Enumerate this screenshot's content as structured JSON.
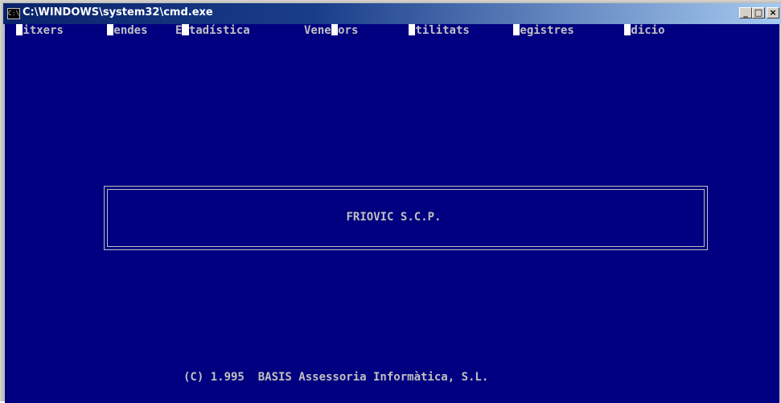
{
  "window": {
    "title": "C:\\WINDOWS\\system32\\cmd.exe",
    "icon_text": "C:\\",
    "controls": {
      "minimize": "_",
      "maximize": "□",
      "close": "×"
    }
  },
  "menu": {
    "items": [
      {
        "hotkey": "F",
        "label": "itxers"
      },
      {
        "hotkey": "V",
        "label": "endes"
      },
      {
        "prefix": "E",
        "hotkey": "s",
        "label": "tadística"
      },
      {
        "prefix": "Vene",
        "hotkey": "d",
        "label": "ors"
      },
      {
        "hotkey": "U",
        "label": "tilitats"
      },
      {
        "hotkey": "R",
        "label": "egistres"
      },
      {
        "hotkey": "E",
        "label": "dicio"
      }
    ]
  },
  "content": {
    "company": "FRIOVIC S.C.P.",
    "copyright": "(C) 1.995  BASIS Assessoria Informàtica, S.L."
  },
  "colors": {
    "console_bg": "#000080",
    "console_fg": "#c0c0c0",
    "title_start": "#0a246a",
    "title_end": "#a6caf0",
    "hotkey_highlight": "#ffffff"
  }
}
